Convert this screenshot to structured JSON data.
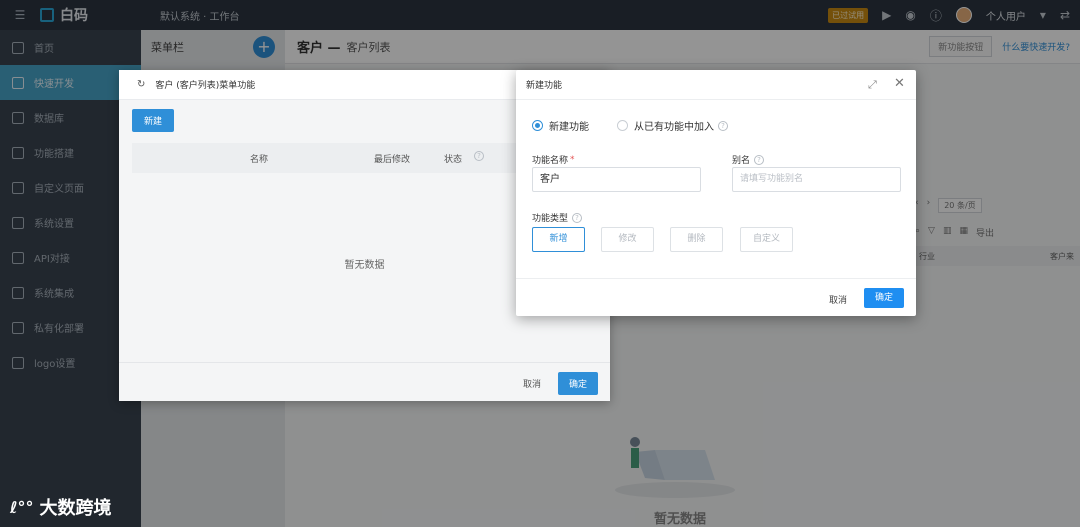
{
  "topbar": {
    "logo_text": "白码",
    "breadcrumb": "默认系统 · 工作台",
    "badge": "已过试用",
    "user_name": "个人用户"
  },
  "sidebar": {
    "items": [
      {
        "label": "首页",
        "icon": "home-icon"
      },
      {
        "label": "快速开发",
        "icon": "cube-icon",
        "active": true
      },
      {
        "label": "数据库",
        "icon": "database-icon"
      },
      {
        "label": "功能搭建",
        "icon": "build-icon"
      },
      {
        "label": "自定义页面",
        "icon": "page-icon"
      },
      {
        "label": "系统设置",
        "icon": "settings-icon"
      },
      {
        "label": "API对接",
        "icon": "api-icon"
      },
      {
        "label": "系统集成",
        "icon": "integration-icon"
      },
      {
        "label": "私有化部署",
        "icon": "deploy-icon"
      },
      {
        "label": "logo设置",
        "icon": "logo-icon"
      }
    ]
  },
  "menucol": {
    "title": "菜单栏",
    "add_label": "+"
  },
  "main": {
    "title": "客户 —",
    "subtitle": "客户列表",
    "quick_btn": "新功能按钮",
    "help_link": "什么要快速开发?",
    "page_size": "20 条/页",
    "export_label": "导出",
    "col1": "行业",
    "col2": "客户来",
    "empty_text": "暂无数据"
  },
  "dialog_back": {
    "title": "客户 (客户列表)菜单功能",
    "new_button": "新建",
    "columns": {
      "name": "名称",
      "modified": "最后修改",
      "status": "状态"
    },
    "empty_text": "暂无数据",
    "cancel": "取消",
    "ok": "确定"
  },
  "dialog": {
    "title": "新建功能",
    "radio_new": "新建功能",
    "radio_existing": "从已有功能中加入",
    "name_label": "功能名称",
    "name_required": "*",
    "name_value": "客户",
    "alias_label": "别名",
    "alias_placeholder": "请填写功能别名",
    "type_label": "功能类型",
    "types": [
      "新增",
      "修改",
      "删除",
      "自定义"
    ],
    "cancel": "取消",
    "ok": "确定"
  },
  "watermark": {
    "logo": "ℓ°°",
    "text": "大数跨境"
  }
}
